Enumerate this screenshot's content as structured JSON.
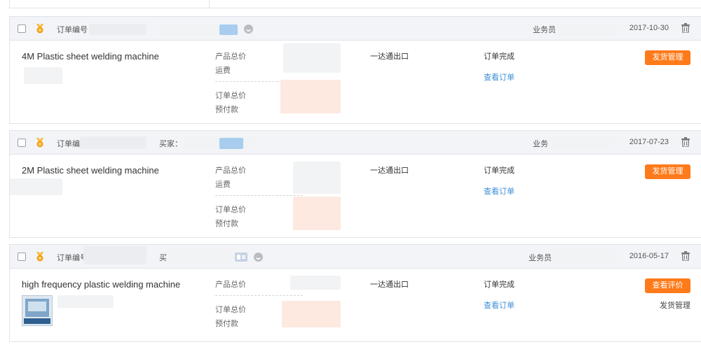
{
  "orders": [
    {
      "header": {
        "order_no_label": "订单编号",
        "buyer_label": "",
        "salesperson_label": "业务员",
        "date": "2017-10-30"
      },
      "product_name": "4M Plastic sheet welding machine",
      "price_labels": {
        "product_total": "产品总价",
        "freight": "运费",
        "order_total": "订单总价",
        "prepay": "预付款"
      },
      "shipping_method": "一达通出口",
      "status": "订单完成",
      "view_order": "查看订单",
      "primary_action": "发货管理"
    },
    {
      "header": {
        "order_no_label": "订单编",
        "buyer_label": "买家：",
        "salesperson_label": "业务",
        "date": "2017-07-23"
      },
      "product_name": "2M Plastic sheet welding machine",
      "price_labels": {
        "product_total": "产品总价",
        "freight": "运费",
        "order_total": "订单总价",
        "prepay": "预付款"
      },
      "shipping_method": "一达通出口",
      "status": "订单完成",
      "view_order": "查看订单",
      "primary_action": "发货管理"
    },
    {
      "header": {
        "order_no_label": "订单编号",
        "buyer_label": "买",
        "salesperson_label": "业务员",
        "date": "2016-05-17"
      },
      "product_name": "high frequency plastic welding machine",
      "price_labels": {
        "product_total": "产品总价",
        "order_total": "订单总价",
        "prepay": "预付款"
      },
      "shipping_method": "一达通出口",
      "status": "订单完成",
      "view_order": "查看订单",
      "primary_action": "查看评价",
      "secondary_action": "发货管理"
    }
  ],
  "icons": {
    "checkbox": "checkbox-icon",
    "medal": "gold-supplier-icon",
    "trash": "trash-icon",
    "id_card": "id-card-icon",
    "chat": "chat-icon"
  },
  "colors": {
    "accent_button": "#ff7a1a",
    "link": "#3b8ed5",
    "header_bg": "#f3f4f7",
    "border": "#dfe3ea"
  }
}
